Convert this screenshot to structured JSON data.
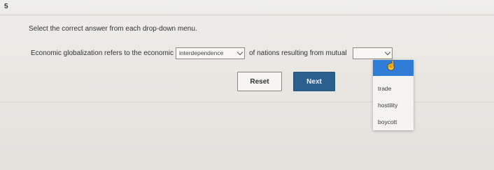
{
  "question": {
    "number": "5",
    "instruction": "Select the correct answer from each drop-down menu.",
    "sentence_part1": "Economic globalization refers to the economic",
    "sentence_part2": "of nations resulting from mutual"
  },
  "dropdown_1": {
    "selected_value": "interdependence"
  },
  "dropdown_2": {
    "selected_value": "",
    "options": [
      "trade",
      "hostility",
      "boycott"
    ]
  },
  "buttons": {
    "reset_label": "Reset",
    "next_label": "Next"
  },
  "colors": {
    "next_button": "#2b5f8e",
    "option_highlight": "#2f7dd6"
  },
  "icons": {
    "dropdown_arrow": "chevron-down-icon",
    "cursor": "hand-pointer-icon"
  }
}
